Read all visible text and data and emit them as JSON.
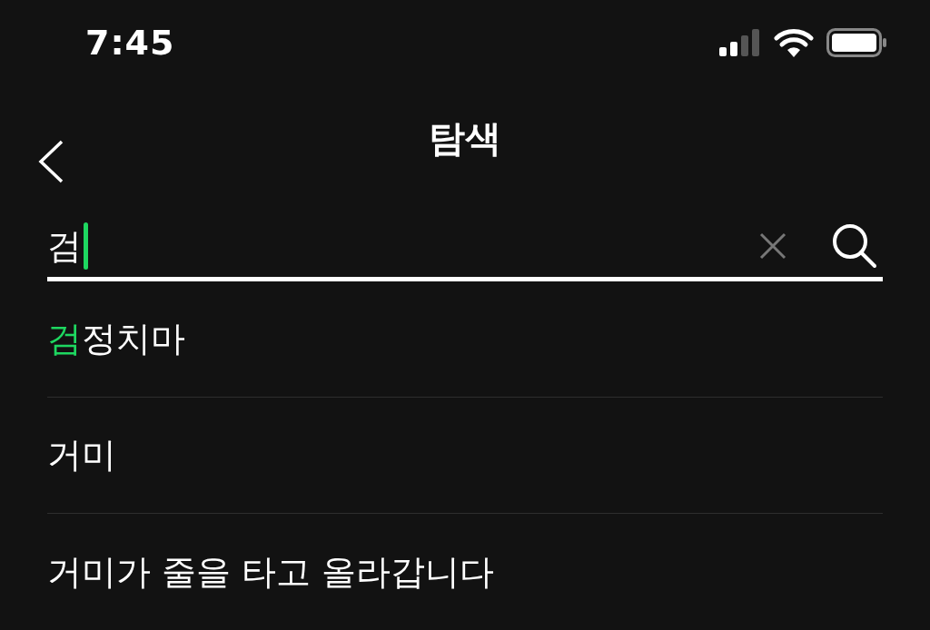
{
  "status_bar": {
    "time": "7:45"
  },
  "nav": {
    "title": "탐색"
  },
  "search": {
    "value": "검"
  },
  "suggestions": [
    {
      "highlight": "검",
      "text": "정치마"
    },
    {
      "text": "거미"
    },
    {
      "text": "거미가 줄을 타고 올라갑니다"
    }
  ]
}
